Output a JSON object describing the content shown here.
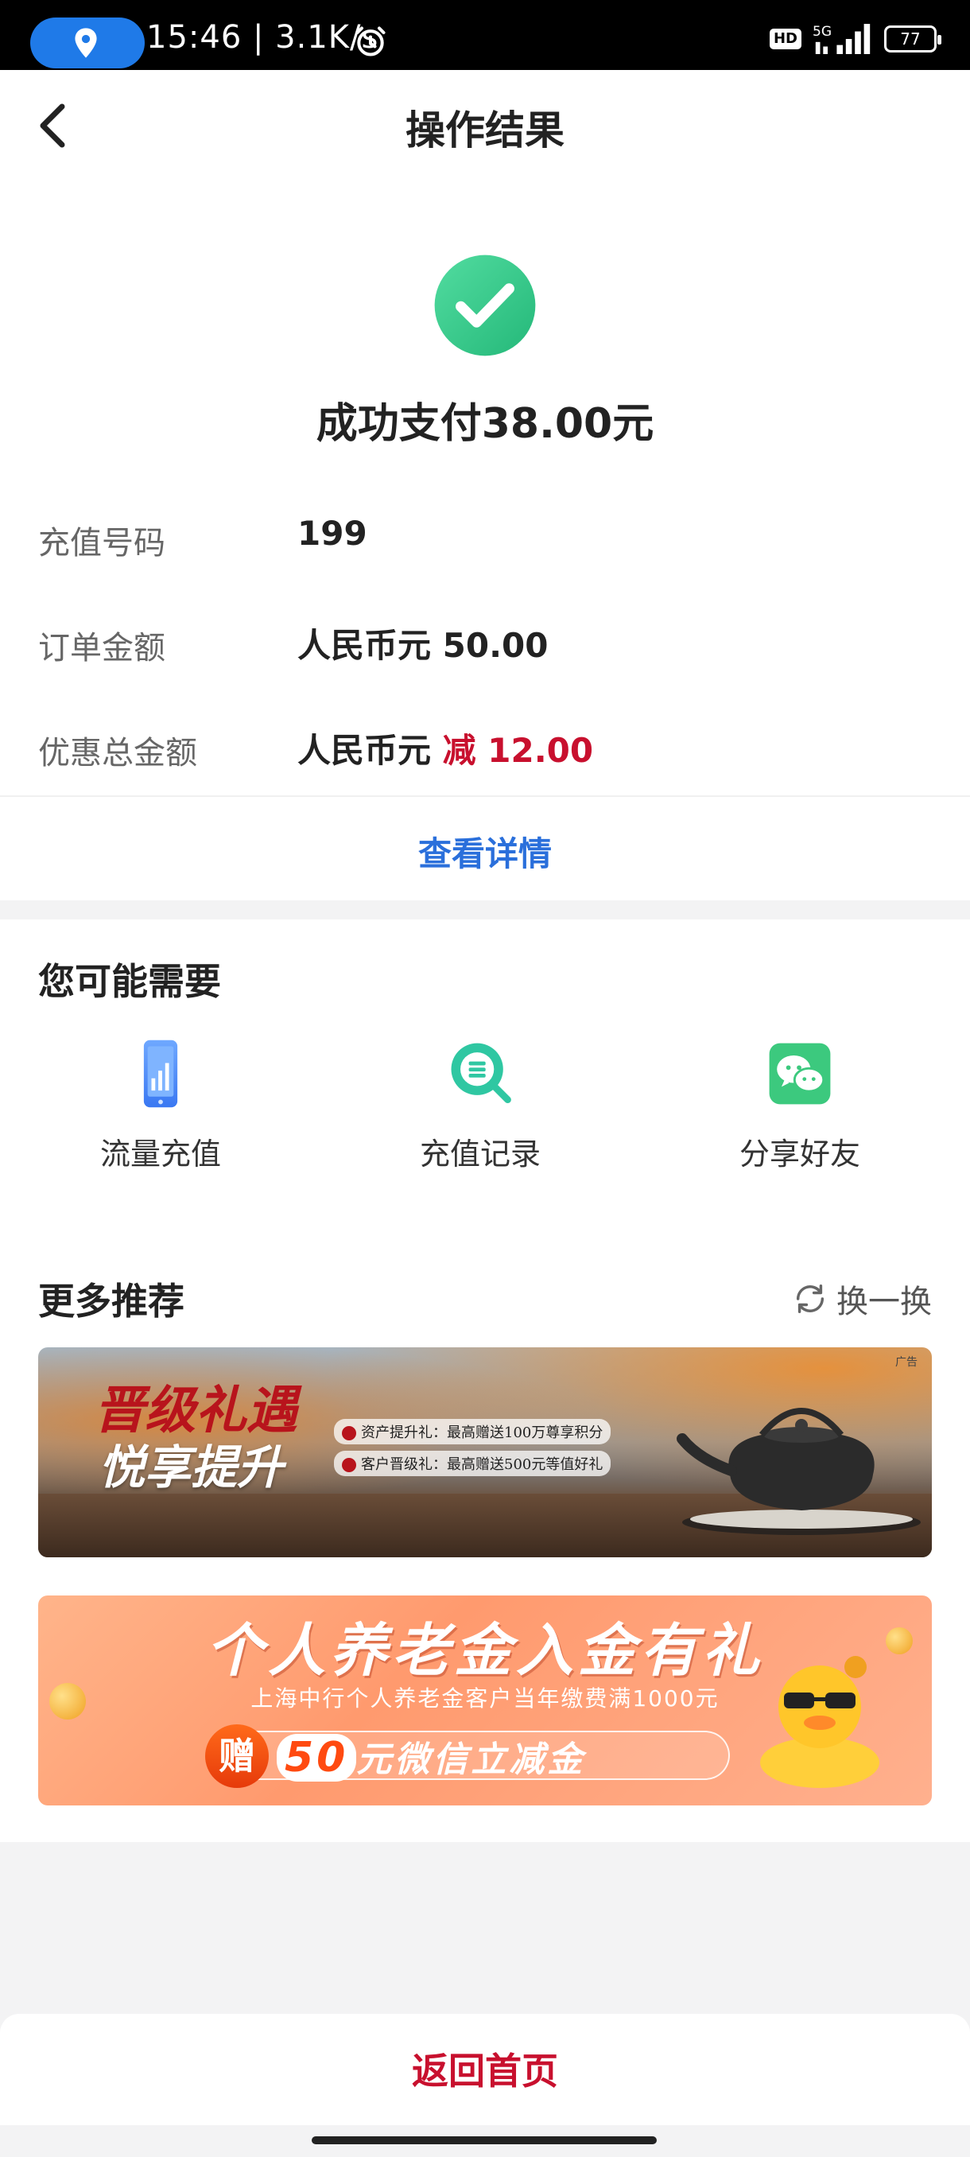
{
  "status_bar": {
    "time": "15:46 | 3.1K/s",
    "hd": "HD",
    "network": "5G",
    "battery": "77"
  },
  "header": {
    "title": "操作结果"
  },
  "result": {
    "status_text": "成功支付38.00元",
    "rows": [
      {
        "label": "充值号码",
        "value": "199"
      },
      {
        "label": "订单金额",
        "value": "人民币元 50.00"
      },
      {
        "label": "优惠总金额",
        "value_prefix": "人民币元",
        "value_accent": "减 12.00"
      }
    ],
    "detail_link": "查看详情"
  },
  "you_may_need": {
    "title": "您可能需要",
    "items": [
      {
        "label": "流量充值",
        "icon": "phone-data-icon"
      },
      {
        "label": "充值记录",
        "icon": "record-search-icon"
      },
      {
        "label": "分享好友",
        "icon": "wechat-icon"
      }
    ]
  },
  "more": {
    "title": "更多推荐",
    "refresh_label": "换一换",
    "banner1": {
      "title": "晋级礼遇",
      "subtitle": "悦享提升",
      "line1": "资产提升礼：最高赠送100万尊享积分",
      "line2": "客户晋级礼：最高赠送500元等值好礼",
      "ad_tag": "广告"
    },
    "banner2": {
      "title": "个人养老金入金有礼",
      "subtitle": "上海中行个人养老金客户当年缴费满1000元",
      "gift_badge": "赠",
      "promo_amount": "50",
      "promo_text": "元微信立减金"
    }
  },
  "bottom": {
    "home_button": "返回首页"
  },
  "colors": {
    "accent_red": "#c8102e",
    "link_blue": "#2a6fdb",
    "success_green": "#3ccf8e"
  }
}
